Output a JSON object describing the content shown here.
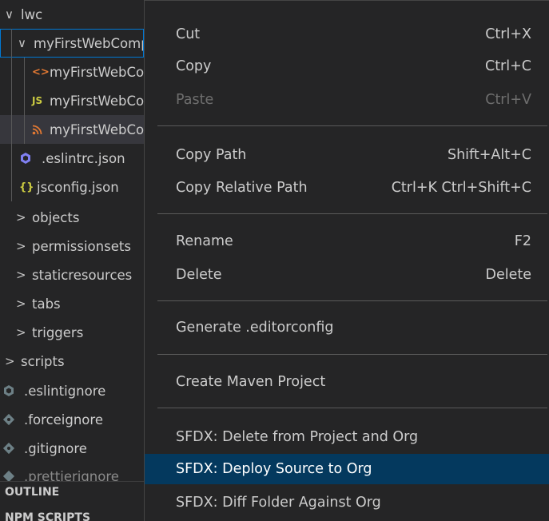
{
  "explorer": {
    "tree": [
      {
        "label": "lwc",
        "twisty": "∨",
        "icon": "",
        "icon_name": ""
      },
      {
        "label": "myFirstWebComponent",
        "twisty": "∨",
        "icon": "",
        "icon_name": ""
      },
      {
        "label": "myFirstWebComponent.html",
        "twisty": "",
        "icon": "<>",
        "icon_name": "html-file-icon"
      },
      {
        "label": "myFirstWebComponent.js",
        "twisty": "",
        "icon": "JS",
        "icon_name": "js-file-icon"
      },
      {
        "label": "myFirstWebComponent.js-meta.xml",
        "twisty": "",
        "icon": "",
        "icon_name": "xml-rss-file-icon"
      },
      {
        "label": ".eslintrc.json",
        "twisty": "",
        "icon": "",
        "icon_name": "eslint-file-icon"
      },
      {
        "label": "jsconfig.json",
        "twisty": "",
        "icon": "{}",
        "icon_name": "json-file-icon"
      },
      {
        "label": "objects",
        "twisty": ">",
        "icon": "",
        "icon_name": ""
      },
      {
        "label": "permissionsets",
        "twisty": ">",
        "icon": "",
        "icon_name": ""
      },
      {
        "label": "staticresources",
        "twisty": ">",
        "icon": "",
        "icon_name": ""
      },
      {
        "label": "tabs",
        "twisty": ">",
        "icon": "",
        "icon_name": ""
      },
      {
        "label": "triggers",
        "twisty": ">",
        "icon": "",
        "icon_name": ""
      },
      {
        "label": "scripts",
        "twisty": ">",
        "icon": "",
        "icon_name": ""
      },
      {
        "label": ".eslintignore",
        "twisty": "",
        "icon": "",
        "icon_name": "eslint-ignore-file-icon"
      },
      {
        "label": ".forceignore",
        "twisty": "",
        "icon": "",
        "icon_name": "ignore-file-icon"
      },
      {
        "label": ".gitignore",
        "twisty": "",
        "icon": "",
        "icon_name": "git-ignore-file-icon"
      },
      {
        "label": ".prettierignore",
        "twisty": "",
        "icon": "",
        "icon_name": "prettier-ignore-file-icon"
      }
    ],
    "panels": {
      "outline": "OUTLINE",
      "npm_scripts": "NPM SCRIPTS"
    }
  },
  "context_menu": {
    "items": [
      {
        "label": "Cut",
        "shortcut": "Ctrl+X"
      },
      {
        "label": "Copy",
        "shortcut": "Ctrl+C"
      },
      {
        "label": "Paste",
        "shortcut": "Ctrl+V"
      },
      {
        "label": "Copy Path",
        "shortcut": "Shift+Alt+C"
      },
      {
        "label": "Copy Relative Path",
        "shortcut": "Ctrl+K Ctrl+Shift+C"
      },
      {
        "label": "Rename",
        "shortcut": "F2"
      },
      {
        "label": "Delete",
        "shortcut": "Delete"
      },
      {
        "label": "Generate .editorconfig",
        "shortcut": ""
      },
      {
        "label": "Create Maven Project",
        "shortcut": ""
      },
      {
        "label": "SFDX: Delete from Project and Org",
        "shortcut": ""
      },
      {
        "label": "SFDX: Deploy Source to Org",
        "shortcut": ""
      },
      {
        "label": "SFDX: Diff Folder Against Org",
        "shortcut": ""
      }
    ]
  },
  "colors": {
    "background": "#252526",
    "menu_highlight": "#04395e",
    "focus_border": "#0078d4",
    "html_icon": "#e37933",
    "js_icon": "#cbcb41",
    "xml_icon": "#e37933",
    "eslint_icon": "#8080f2",
    "json_icon": "#cbcb41",
    "ignore_icon": "#6d8086"
  }
}
